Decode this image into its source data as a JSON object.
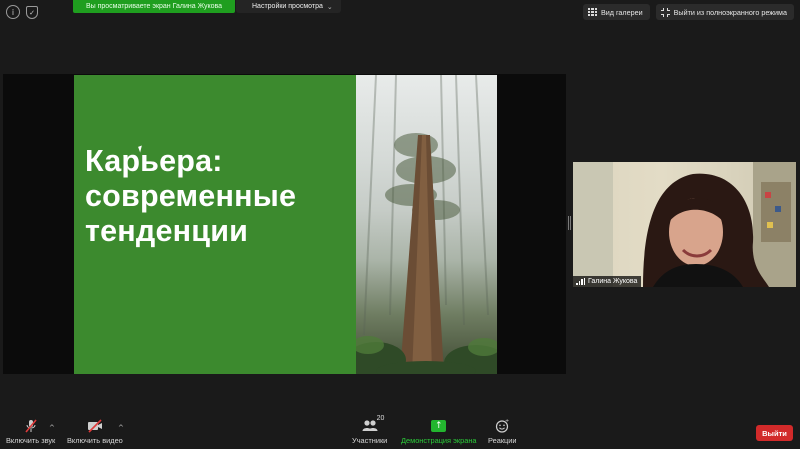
{
  "top_bar": {
    "sharing_banner": "Вы просматриваете экран Галина Жукова",
    "view_options_label": "Настройки просмотра",
    "gallery_view_label": "Вид галереи",
    "exit_fullscreen_label": "Выйти из полноэкранного режима"
  },
  "slide": {
    "title": "Карьера:\nсовременные\nтенденции"
  },
  "participant": {
    "name": "Галина Жукова"
  },
  "toolbar": {
    "unmute_label": "Включить звук",
    "start_video_label": "Включить видео",
    "participants_label": "Участники",
    "participants_count": "20",
    "share_screen_label": "Демонстрация экрана",
    "reactions_label": "Реакции",
    "end_label": "Выйти"
  },
  "colors": {
    "slide_green": "#3c8a2e",
    "share_green": "#23b52f",
    "end_red": "#d22a2a"
  }
}
